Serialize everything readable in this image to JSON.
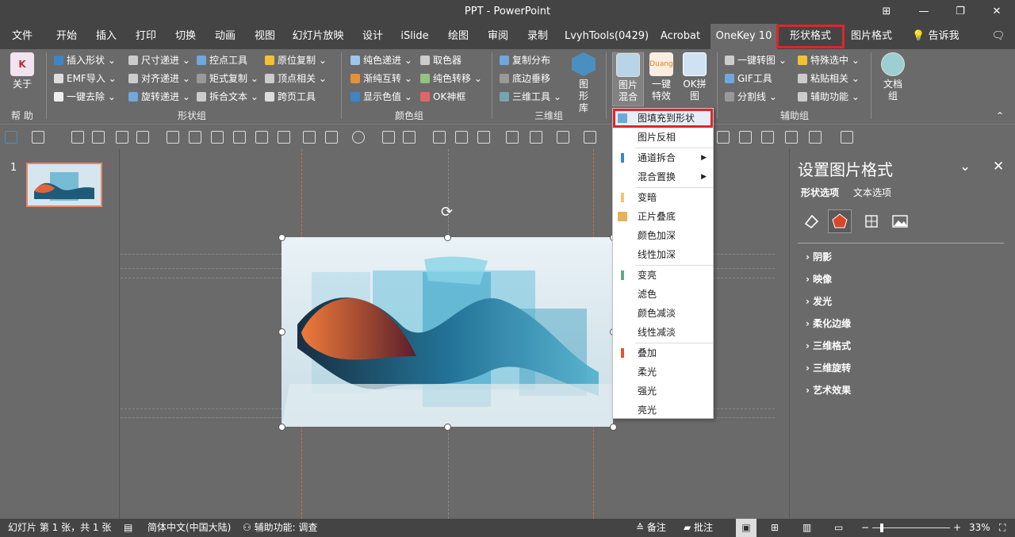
{
  "window": {
    "title": "PPT - PowerPoint",
    "minimize": "—",
    "restore": "❐",
    "close": "✕",
    "ribbon_opt": "⊞"
  },
  "tabs": [
    "文件",
    "开始",
    "插入",
    "打印",
    "切换",
    "动画",
    "视图",
    "幻灯片放映",
    "设计",
    "iSlide",
    "绘图",
    "审阅",
    "录制",
    "LvyhTools(0429)",
    "Acrobat",
    "OneKey 10",
    "形状格式",
    "图片格式",
    "告诉我"
  ],
  "ribbon": {
    "help": {
      "label": "关于",
      "group": "帮 助"
    },
    "shape_group": {
      "label": "形状组",
      "items": [
        "插入形状",
        "尺寸递进",
        "控点工具",
        "原位复制",
        "EMF导入",
        "对齐递进",
        "矩式复制",
        "顶点相关",
        "一键去除",
        "旋转递进",
        "拆合文本",
        "跨页工具"
      ]
    },
    "color_group": {
      "label": "颜色组",
      "items": [
        "纯色递进",
        "取色器",
        "渐纯互转",
        "纯色转移",
        "显示色值",
        "OK神框"
      ]
    },
    "3d_group": {
      "label": "三维组",
      "items": [
        "复制分布",
        "底边垂移",
        "三维工具"
      ],
      "big": "图形库"
    },
    "image_group": {
      "big": [
        "图片混合",
        "一键特效",
        "OK拼图"
      ]
    },
    "aux_group": {
      "label": "辅助组",
      "items": [
        "一键转图",
        "特殊选中",
        "GIF工具",
        "粘贴相关",
        "分割线",
        "辅助功能"
      ]
    },
    "doc_group": {
      "label": "文档组"
    }
  },
  "menu": {
    "items": [
      "图填充到形状",
      "图片反相",
      "通道拆合",
      "混合置换",
      "变暗",
      "正片叠底",
      "颜色加深",
      "线性加深",
      "变亮",
      "滤色",
      "颜色减淡",
      "线性减淡",
      "叠加",
      "柔光",
      "强光",
      "亮光"
    ]
  },
  "thumbs": {
    "slide_number": "1"
  },
  "pane": {
    "title": "设置图片格式",
    "tabs": [
      "形状选项",
      "文本选项"
    ],
    "sections": [
      "阴影",
      "映像",
      "发光",
      "柔化边缘",
      "三维格式",
      "三维旋转",
      "艺术效果"
    ]
  },
  "status": {
    "slide_info": "幻灯片 第 1 张，共 1 张",
    "lang": "简体中文(中国大陆)",
    "access": "辅助功能: 调查",
    "notes": "备注",
    "comments": "批注",
    "zoom": "33%"
  },
  "colors": {
    "accent_red": "#e0242b",
    "dark_bar": "#444444",
    "background": "#6a6a6a"
  }
}
